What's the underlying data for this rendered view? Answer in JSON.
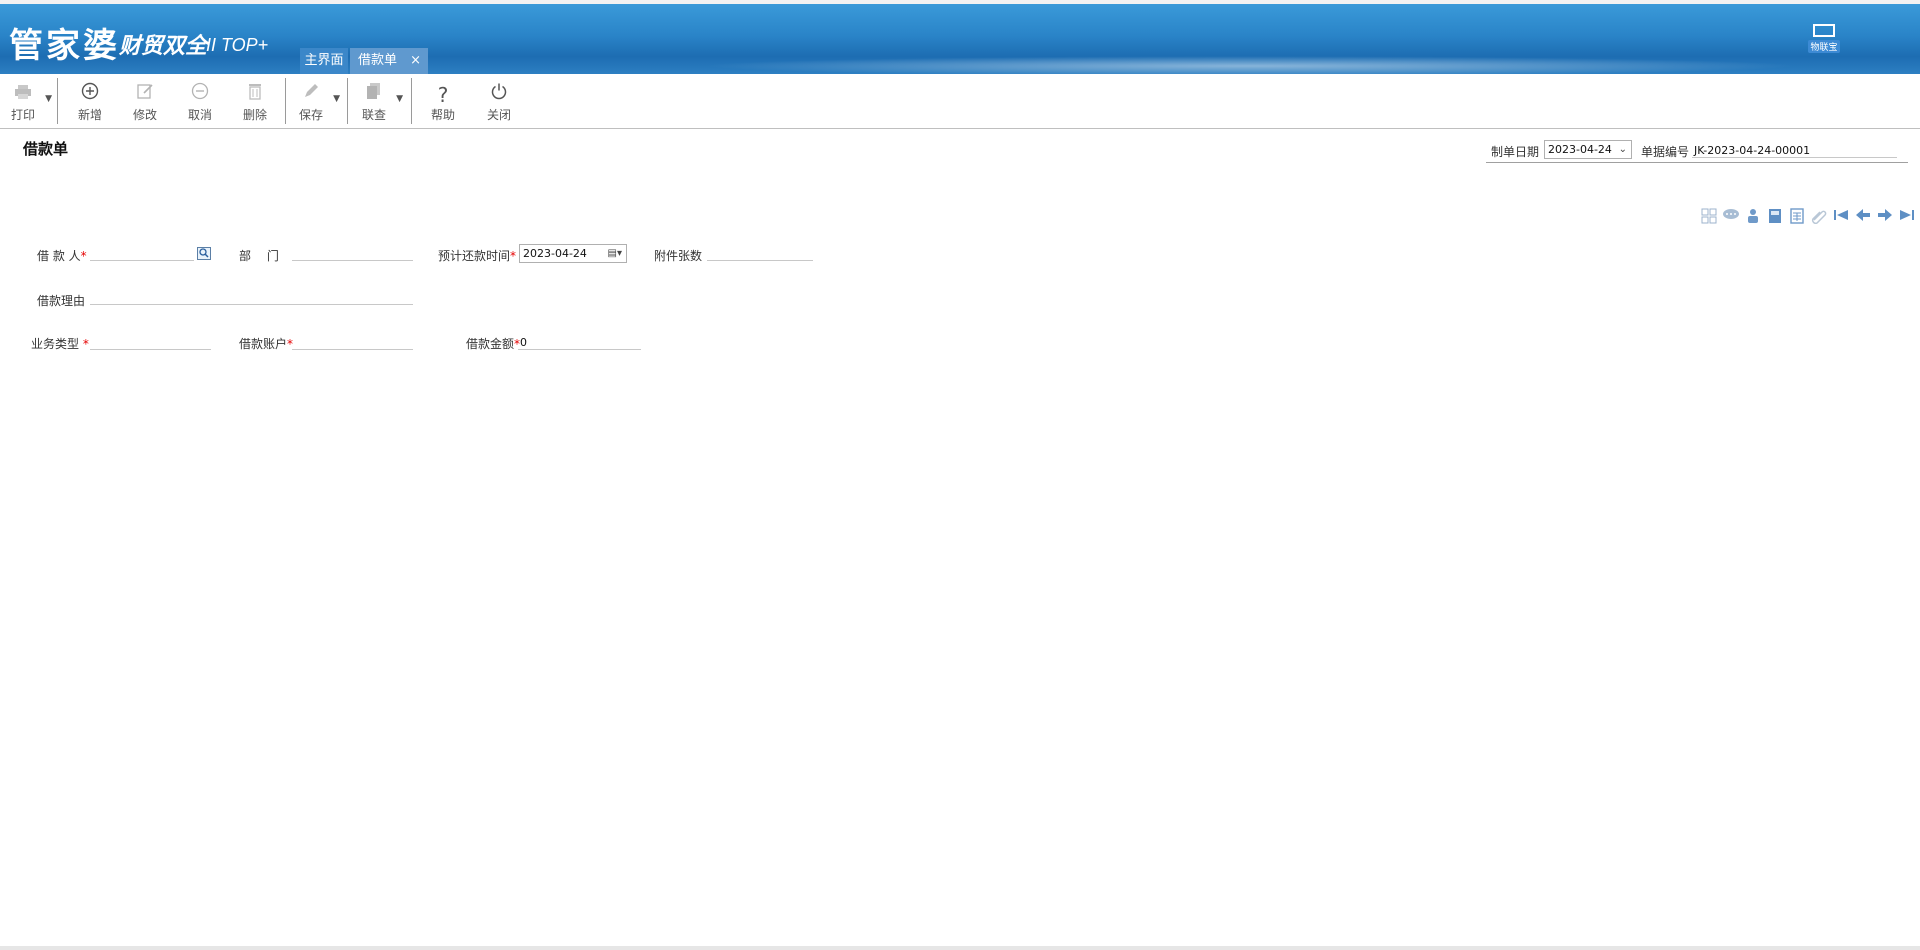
{
  "header": {
    "logo_main": "管家婆",
    "logo_sub": "财贸双全",
    "logo_version": "II TOP+",
    "tabs": [
      {
        "label": "主界面"
      },
      {
        "label": "借款单",
        "close": "×"
      }
    ],
    "badge_label": "物联宝"
  },
  "toolbar": {
    "print": "打印",
    "add": "新增",
    "edit": "修改",
    "cancel": "取消",
    "delete": "删除",
    "save": "保存",
    "query": "联查",
    "help": "帮助",
    "close": "关闭"
  },
  "doc": {
    "title": "借款单",
    "date_label": "制单日期",
    "date_value": "2023-04-24",
    "number_label": "单据编号",
    "number_value": "JK-2023-04-24-00001"
  },
  "form": {
    "borrower_label": "借 款 人",
    "required_mark": "*",
    "department_label": "部 门",
    "return_time_label": "预计还款时间",
    "return_time_value": "2023-04-24",
    "attachments_label": "附件张数",
    "reason_label": "借款理由",
    "business_type_label": "业务类型",
    "account_label": "借款账户",
    "amount_label": "借款金额",
    "amount_value": "0"
  },
  "icons": {
    "toolbar": [
      "printer-icon",
      "plus-circle-icon",
      "edit-icon",
      "minus-circle-icon",
      "trash-icon",
      "pen-icon",
      "documents-icon",
      "question-icon",
      "power-icon"
    ],
    "nav": [
      "grid-icon",
      "chat-icon",
      "users-icon",
      "save-icon",
      "calculator-icon",
      "attachment-icon",
      "first-icon",
      "prev-icon",
      "next-icon",
      "last-icon"
    ]
  }
}
